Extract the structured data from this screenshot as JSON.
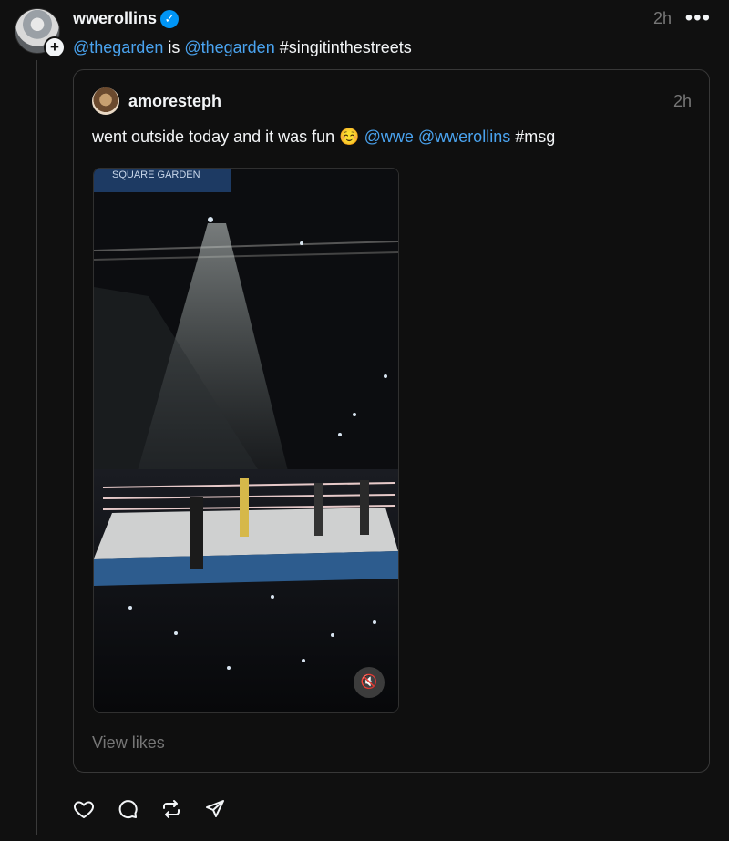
{
  "post": {
    "username": "wwerollins",
    "time": "2h",
    "text_parts": {
      "mention1": "@thegarden",
      "middle": " is ",
      "mention2": "@thegarden",
      "hashtag": " #singitinthestreets"
    }
  },
  "quoted_post": {
    "username": "amoresteph",
    "time": "2h",
    "text_parts": {
      "lead": "went outside today and it was fun ",
      "emoji": "☺️",
      "mention1": "@wwe",
      "mention2": "@wwerollins",
      "hashtag": "#msg"
    },
    "media_banner": "SQUARE GARDEN",
    "view_likes": "View likes"
  },
  "icons": {
    "verified": "verified-badge-icon",
    "more": "more-options-icon",
    "mute": "muted-speaker-icon",
    "like": "heart-icon",
    "reply": "comment-icon",
    "repost": "repost-icon",
    "share": "send-icon"
  },
  "colors": {
    "background": "#101010",
    "mention": "#4aa3ef",
    "verified": "#0095f6",
    "muted_text": "#777777"
  }
}
